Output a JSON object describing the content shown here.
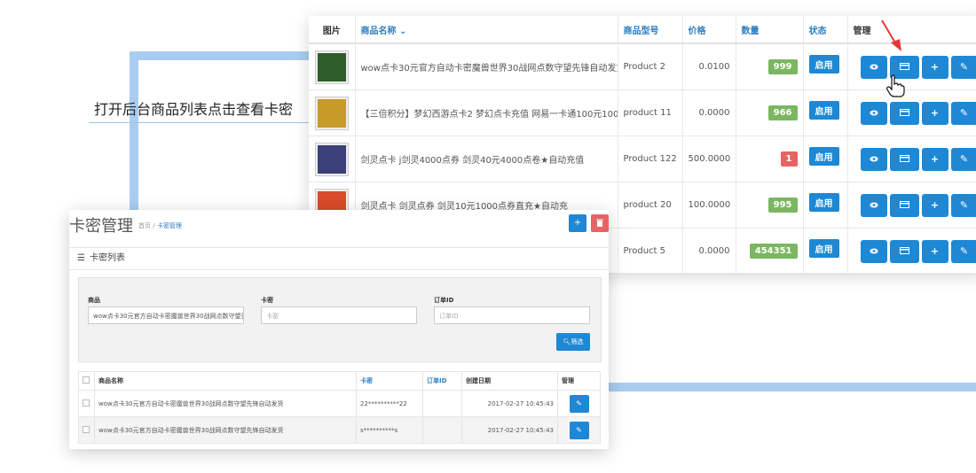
{
  "caption": "打开后台商品列表点击查看卡密",
  "product_table": {
    "headers": {
      "image": "图片",
      "name": "商品名称 ⌄",
      "model": "商品型号",
      "price": "价格",
      "quantity": "数量",
      "status": "状态",
      "manage": "管理"
    },
    "rows": [
      {
        "name": "wow点卡30元官方自动卡密魔兽世界30战网点数守望先锋自动发货",
        "model": "Product 2",
        "price": "0.0100",
        "qty": "999",
        "qty_color": "#7bb661",
        "status": "启用",
        "thumb_color": "#2e5e2a"
      },
      {
        "name": "【三倍积分】梦幻西游点卡2 梦幻点卡充值 网易一卡通100元1000点",
        "model": "product 11",
        "price": "0.0000",
        "qty": "966",
        "qty_color": "#7bb661",
        "status": "启用",
        "thumb_color": "#c79a2a"
      },
      {
        "name": "剑灵点卡 j剑灵4000点券 剑灵40元4000点卷★自动充值",
        "model": "Product 122",
        "price": "500.0000",
        "qty": "1",
        "qty_color": "#e86363",
        "status": "启用",
        "thumb_color": "#3b3f7a"
      },
      {
        "name": "剑灵点卡 剑灵点券 剑灵10元1000点券直充★自动充",
        "model": "product 20",
        "price": "100.0000",
        "qty": "995",
        "qty_color": "#7bb661",
        "status": "启用",
        "thumb_color": "#d94b2b"
      },
      {
        "name": "",
        "model": "Product 5",
        "price": "0.0000",
        "qty": "454351",
        "qty_color": "#7bb661",
        "status": "启用",
        "thumb_color": "#ffffff"
      }
    ]
  },
  "card_panel": {
    "title": "卡密管理",
    "breadcrumb_home": "首页",
    "breadcrumb_sep": "/",
    "breadcrumb_current": "卡密管理",
    "add_label": "+",
    "delete_label": "🗑",
    "list_title": "卡密列表",
    "filters": {
      "product_label": "商品",
      "product_value": "wow点卡30元官方自动卡密魔兽世界30战网点数守望先锋自动发货",
      "card_label": "卡密",
      "card_placeholder": "卡密",
      "order_label": "订单ID",
      "order_placeholder": "订单ID",
      "filter_button": "筛选"
    },
    "table": {
      "headers": {
        "name": "商品名称",
        "card": "卡密",
        "order": "订单ID",
        "date": "创建日期",
        "manage": "管理"
      },
      "rows": [
        {
          "name": "wow点卡30元官方自动卡密魔兽世界30战网点数守望先锋自动发货",
          "card": "22**********22",
          "order": "",
          "date": "2017-02-27 10:45:43"
        },
        {
          "name": "wow点卡30元官方自动卡密魔兽世界30战网点数守望先锋自动发货",
          "card": "s**********s",
          "order": "",
          "date": "2017-02-27 10:45:43"
        }
      ]
    }
  },
  "icons": [
    "eye-icon",
    "card-icon",
    "plus-icon",
    "pencil-icon",
    "list-icon",
    "search-icon",
    "trash-icon",
    "cursor-hand-icon",
    "red-arrow-icon"
  ],
  "colors": {
    "accent": "#1e88d5",
    "decor": "#a9cdf1",
    "arrow": "#e53935"
  }
}
